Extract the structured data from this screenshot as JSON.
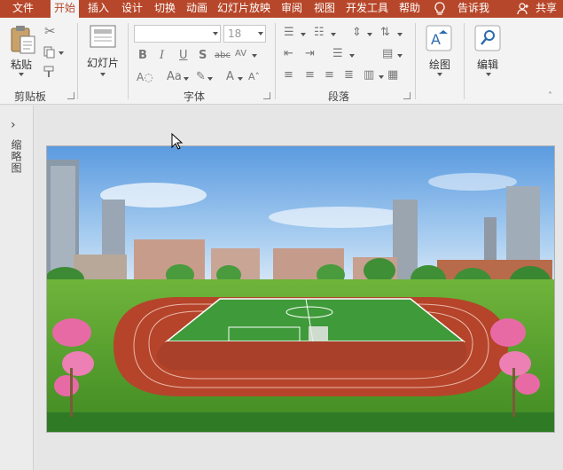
{
  "tabs": [
    {
      "label": "文件",
      "active": false
    },
    {
      "label": "开始",
      "active": true
    },
    {
      "label": "插入",
      "active": false
    },
    {
      "label": "设计",
      "active": false
    },
    {
      "label": "切换",
      "active": false
    },
    {
      "label": "动画",
      "active": false
    },
    {
      "label": "幻灯片放映",
      "active": false
    },
    {
      "label": "审阅",
      "active": false
    },
    {
      "label": "视图",
      "active": false
    },
    {
      "label": "开发工具",
      "active": false
    },
    {
      "label": "帮助",
      "active": false
    }
  ],
  "tell_me": "告诉我",
  "share": "共享",
  "clipboard": {
    "paste_label": "粘贴",
    "group_label": "剪贴板"
  },
  "slides": {
    "new_slide_label": "幻灯片"
  },
  "font": {
    "font_name": "",
    "font_size": "18",
    "group_label": "字体",
    "strike_label": "abc",
    "case_label": "Aa"
  },
  "paragraph": {
    "group_label": "段落"
  },
  "drawing": {
    "label": "绘图"
  },
  "editing": {
    "label": "编辑"
  },
  "thumbnails_label": "缩略图",
  "colors": {
    "accent": "#b7472a",
    "sky": "#7fb4e6",
    "grass": "#4f9a2c",
    "track": "#b5442a",
    "field": "#3f9a3a"
  }
}
